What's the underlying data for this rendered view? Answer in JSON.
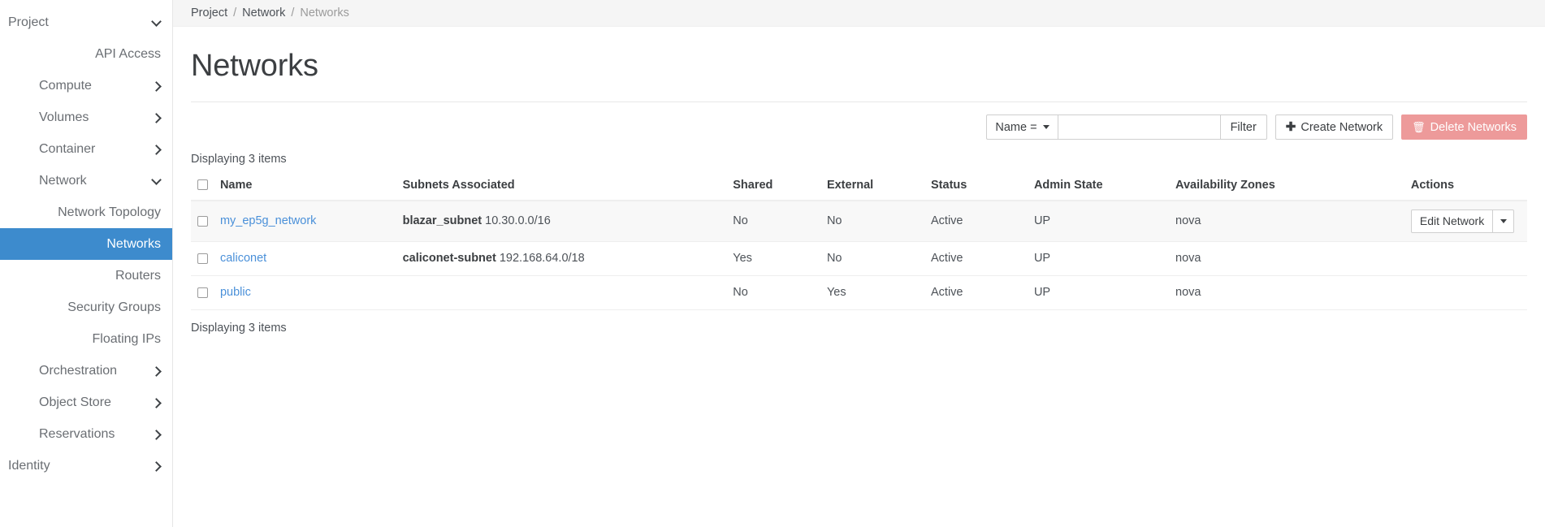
{
  "sidebar": {
    "items": [
      {
        "label": "Project",
        "type": "group",
        "level": 0,
        "icon": "chevron-down-icon"
      },
      {
        "label": "API Access",
        "type": "child",
        "level": 1,
        "selected": false
      },
      {
        "label": "Compute",
        "type": "group",
        "level": 1,
        "icon": "chevron-right-icon"
      },
      {
        "label": "Volumes",
        "type": "group",
        "level": 1,
        "icon": "chevron-right-icon"
      },
      {
        "label": "Container",
        "type": "group",
        "level": 1,
        "icon": "chevron-right-icon"
      },
      {
        "label": "Network",
        "type": "group",
        "level": 1,
        "icon": "chevron-down-icon"
      },
      {
        "label": "Network Topology",
        "type": "child",
        "level": 2,
        "selected": false
      },
      {
        "label": "Networks",
        "type": "child",
        "level": 2,
        "selected": true
      },
      {
        "label": "Routers",
        "type": "child",
        "level": 2,
        "selected": false
      },
      {
        "label": "Security Groups",
        "type": "child",
        "level": 2,
        "selected": false
      },
      {
        "label": "Floating IPs",
        "type": "child",
        "level": 2,
        "selected": false
      },
      {
        "label": "Orchestration",
        "type": "group",
        "level": 1,
        "icon": "chevron-right-icon"
      },
      {
        "label": "Object Store",
        "type": "group",
        "level": 1,
        "icon": "chevron-right-icon"
      },
      {
        "label": "Reservations",
        "type": "group",
        "level": 1,
        "icon": "chevron-right-icon"
      },
      {
        "label": "Identity",
        "type": "group",
        "level": 0,
        "icon": "chevron-right-icon"
      }
    ]
  },
  "breadcrumb": {
    "items": [
      "Project",
      "Network",
      "Networks"
    ],
    "separator": "/"
  },
  "page": {
    "title": "Networks",
    "count_top": "Displaying 3 items",
    "count_bottom": "Displaying 3 items"
  },
  "toolbar": {
    "filter_select_label": "Name =",
    "filter_input_value": "",
    "filter_input_placeholder": "",
    "filter_button_label": "Filter",
    "create_button_label": "Create Network",
    "create_button_icon": "plus-icon",
    "delete_button_label": "Delete Networks",
    "delete_button_icon": "trash-icon"
  },
  "table": {
    "columns": [
      "Name",
      "Subnets Associated",
      "Shared",
      "External",
      "Status",
      "Admin State",
      "Availability Zones",
      "Actions"
    ],
    "rows": [
      {
        "name": "my_ep5g_network",
        "subnet_name": "blazar_subnet",
        "subnet_cidr": "10.30.0.0/16",
        "shared": "No",
        "external": "No",
        "status": "Active",
        "admin_state": "UP",
        "availability_zones": "nova",
        "action_label": "Edit Network",
        "show_actions": true,
        "hovered": true
      },
      {
        "name": "caliconet",
        "subnet_name": "caliconet-subnet",
        "subnet_cidr": "192.168.64.0/18",
        "shared": "Yes",
        "external": "No",
        "status": "Active",
        "admin_state": "UP",
        "availability_zones": "nova",
        "action_label": "Edit Network",
        "show_actions": false,
        "hovered": false
      },
      {
        "name": "public",
        "subnet_name": "",
        "subnet_cidr": "",
        "shared": "No",
        "external": "Yes",
        "status": "Active",
        "admin_state": "UP",
        "availability_zones": "nova",
        "action_label": "Edit Network",
        "show_actions": false,
        "hovered": false
      }
    ]
  },
  "colors": {
    "selected_nav": "#3d8bcd",
    "link": "#4a90d9",
    "delete_button": "#ed9a9a",
    "breadcrumb_bg": "#f5f5f5"
  }
}
